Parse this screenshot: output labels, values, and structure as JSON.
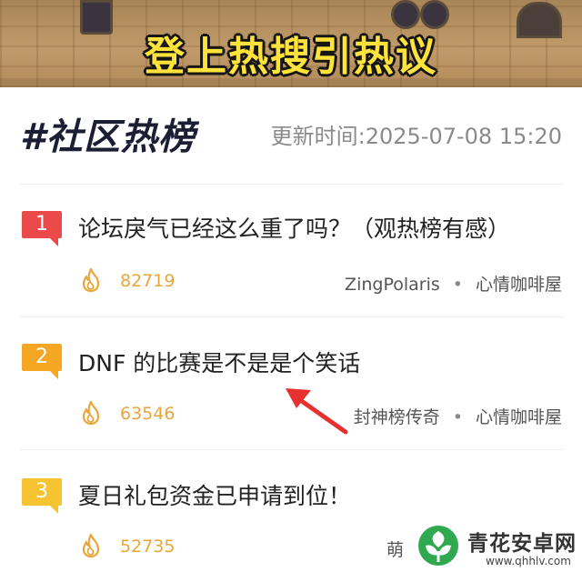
{
  "banner": {
    "title": "登上热搜引热议"
  },
  "board": {
    "title": "#社区热榜",
    "update_time": "更新时间:2025-07-08 15:20"
  },
  "entries": [
    {
      "rank": "1",
      "title": "论坛戾气已经这么重了吗？（观热榜有感）",
      "heat": "82719",
      "author": "ZingPolaris",
      "forum": "心情咖啡屋",
      "rank_color": "#ec4a4a"
    },
    {
      "rank": "2",
      "title": "DNF 的比赛是不是是个笑话",
      "heat": "63546",
      "author": "封神榜传奇",
      "forum": "心情咖啡屋",
      "rank_color": "#f5a623"
    },
    {
      "rank": "3",
      "title": "夏日礼包资金已申请到位！",
      "heat": "52735",
      "author": "萌",
      "forum": "",
      "rank_color": "#f6c431"
    }
  ],
  "watermark": {
    "name": "青花安卓网",
    "url": "www.qhhlv.com"
  },
  "colors": {
    "heat": "#e9a63a",
    "arrow": "#e8312f",
    "banner_text": "#ffe23a"
  }
}
